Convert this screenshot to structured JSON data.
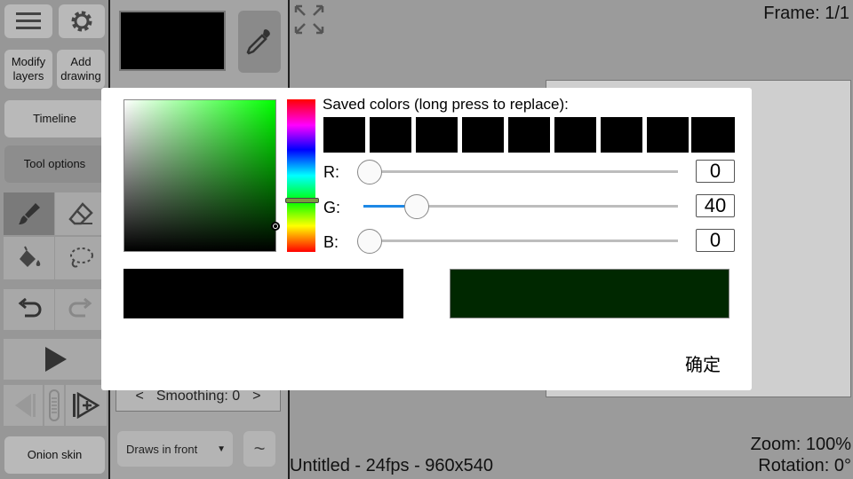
{
  "toolbar": {
    "modify_layers_label": "Modify layers",
    "add_drawing_label": "Add drawing",
    "timeline_label": "Timeline",
    "tool_options_label": "Tool options",
    "onion_skin_label": "Onion skin"
  },
  "tool_panel": {
    "smoothing_prev": "<",
    "smoothing_label": "Smoothing: 0",
    "smoothing_next": ">",
    "draw_order_value": "Draws in front",
    "draw_order_arrow": "▼",
    "wave_glyph": "~",
    "current_color": "#000000"
  },
  "canvas": {
    "frame_label": "Frame: 1/1",
    "file_info": "Untitled - 24fps - 960x540",
    "zoom_label": "Zoom: 100%",
    "rotation_label": "Rotation: 0°"
  },
  "dialog": {
    "saved_colors_title": "Saved colors (long press to replace):",
    "saved_colors": [
      "#000000",
      "#000000",
      "#000000",
      "#000000",
      "#000000",
      "#000000",
      "#000000",
      "#000000",
      "#000000"
    ],
    "channels": [
      {
        "label": "R:",
        "value": "0"
      },
      {
        "label": "G:",
        "value": "40"
      },
      {
        "label": "B:",
        "value": "0"
      }
    ],
    "old_color": "#000000",
    "new_color": "#002800",
    "hue_color": "#00ff00",
    "ok_label": "确定"
  },
  "icons": {
    "menu": "menu-icon",
    "settings": "gear-icon",
    "brush": "brush-icon",
    "eraser": "eraser-icon",
    "fill": "paint-bucket-icon",
    "lasso": "lasso-icon",
    "undo": "undo-icon",
    "redo": "redo-icon",
    "play": "play-icon",
    "prev_frame": "previous-frame-icon",
    "add_frame": "add-frame-icon",
    "eyedropper": "eyedropper-icon",
    "fullscreen": "fullscreen-icon"
  }
}
